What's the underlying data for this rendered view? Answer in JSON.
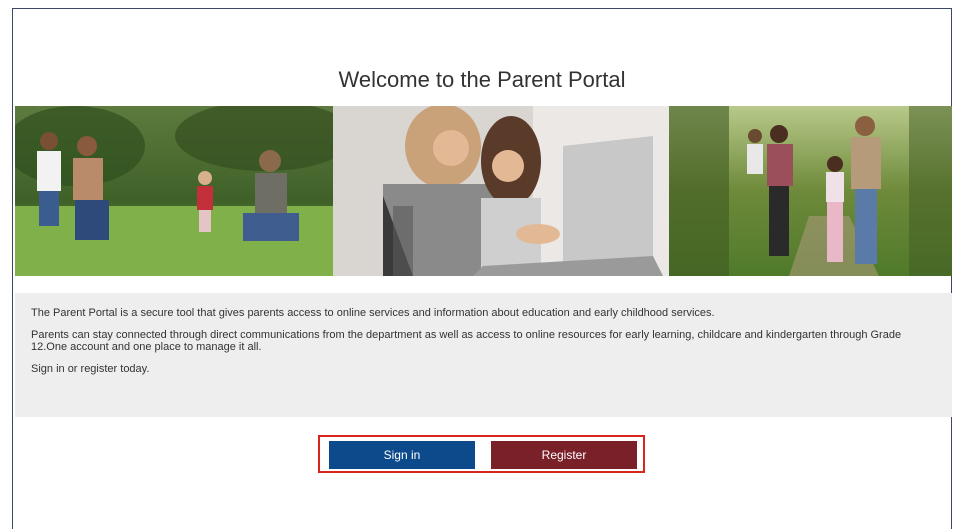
{
  "page": {
    "title": "Welcome to the Parent Portal"
  },
  "info": {
    "paragraph1": "The Parent Portal is a secure tool that gives parents access to online services and information about education and early childhood services.",
    "paragraph2": "Parents can stay connected through direct communications from the department as well as access to online resources for early learning, childcare and kindergarten through Grade 12.One account and one place to manage it all.",
    "paragraph3": "Sign in or register today."
  },
  "actions": {
    "signin_label": "Sign in",
    "register_label": "Register"
  },
  "colors": {
    "signin": "#0d4a8c",
    "register": "#7a2029",
    "highlight": "#d9261c",
    "info_bg": "#eeeeee"
  }
}
